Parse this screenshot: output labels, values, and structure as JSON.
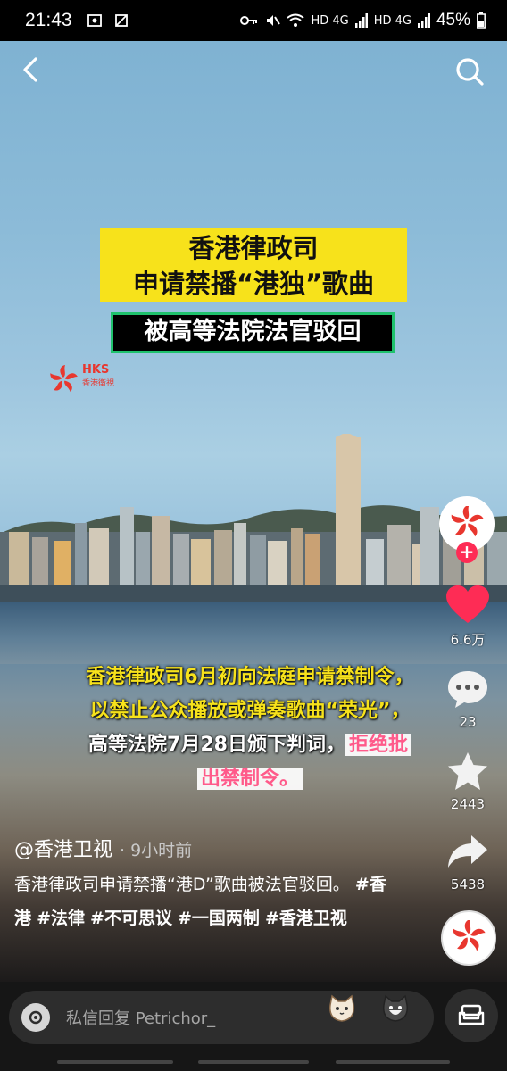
{
  "status_bar": {
    "time": "21:43",
    "network": "HD 4G",
    "network2": "HD 4G",
    "battery": "45%"
  },
  "video": {
    "title_line1": "香港律政司",
    "title_line2": "申请禁播“港独”歌曲",
    "subtitle": "被高等法院法官驳回",
    "logo_text": "HKS",
    "logo_sub": "香港衛視",
    "caption": {
      "line1": "香港律政司6月初向法庭申请禁制令，",
      "line2": "以禁止公众播放或弹奏歌曲“荣光”，",
      "line3_white": "高等法院7月28日颁下判词，",
      "line3_pink": "拒绝批",
      "line4_pink": "出禁制令。"
    }
  },
  "rail": {
    "likes": "6.6万",
    "comments": "23",
    "favorites": "2443",
    "shares": "5438"
  },
  "post": {
    "author": "@香港卫视",
    "time_ago": "· 9小时前",
    "desc_text": "香港律政司申请禁播“港D”歌曲被法官驳回。",
    "tags": [
      "#香港",
      "#法律",
      "#不可思议",
      "#一国两制",
      "#香港卫视"
    ]
  },
  "bottom": {
    "reply_placeholder": "私信回复 Petrichor_"
  },
  "colors": {
    "accent_red": "#fe2c55",
    "banner_yellow": "#f7e21b",
    "banner_border_green": "#1fc26d",
    "logo_red": "#e8372f"
  },
  "icons": [
    "back-icon",
    "search-icon",
    "heart-icon",
    "comment-icon",
    "star-icon",
    "share-icon",
    "camera-icon",
    "couch-icon",
    "bauhinia-logo-icon"
  ]
}
